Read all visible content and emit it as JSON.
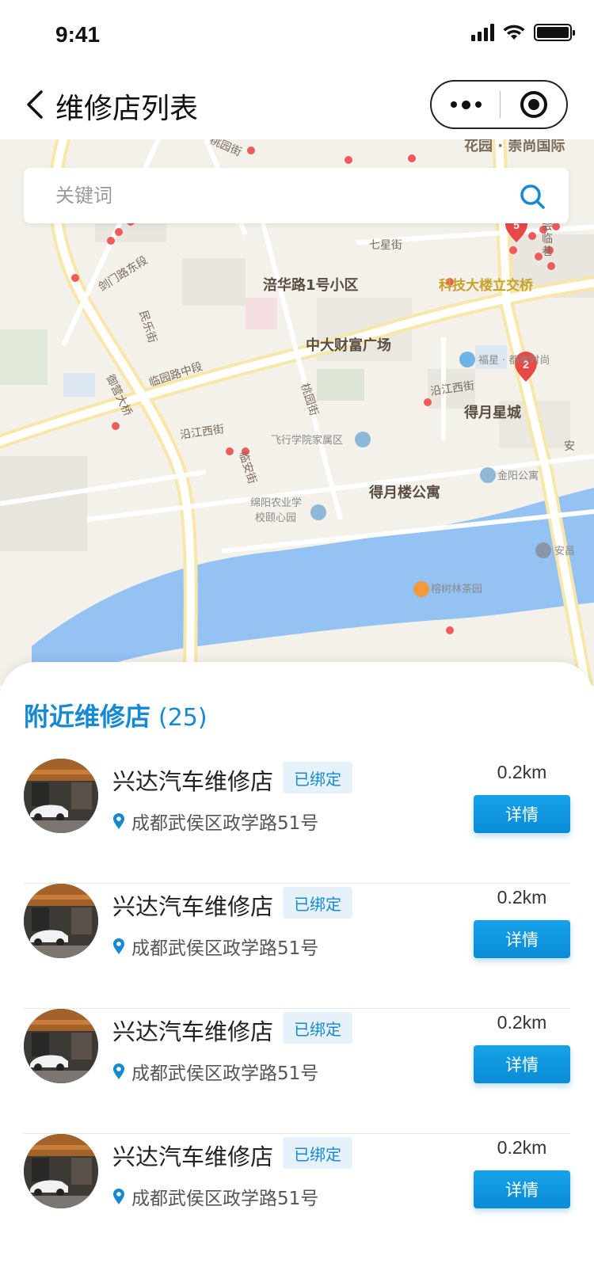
{
  "status_bar": {
    "time": "9:41"
  },
  "nav": {
    "title": "维修店列表"
  },
  "search": {
    "placeholder": "关键词"
  },
  "map": {
    "labels": {
      "l1": "花园 · 崇尚国际",
      "l2": "七星街",
      "l3": "涪华路1号小区",
      "l4": "科技大楼立交桥",
      "l5": "剑门路东段",
      "l6": "民乐街",
      "l7": "中大财富广场",
      "l8": "临园路中段",
      "l9": "福星 · 都市时尚",
      "l10": "沿江西街",
      "l11": "得月星城",
      "l12": "桃园街",
      "l13": "沿江西街",
      "l14": "飞行学院家属区",
      "l15": "临安街",
      "l16": "金阳公寓",
      "l17": "得月楼公寓",
      "l18": "绵阳农业学",
      "l19": "校颐心园",
      "l20": "榕树林茶园",
      "l21": "御营大桥",
      "l22": "桃园街",
      "l23": "安昌",
      "l24": "会",
      "l25": "临",
      "l26": "巷",
      "l27": "路",
      "l28": "安"
    },
    "markers": {
      "m1": "5",
      "m2": "2"
    }
  },
  "panel": {
    "title": "附近维修店",
    "count": "(25)"
  },
  "shops": [
    {
      "name": "兴达汽车维修店",
      "badge": "已绑定",
      "address": "成都武侯区政学路51号",
      "distance": "0.2km",
      "button": "详情"
    },
    {
      "name": "兴达汽车维修店",
      "badge": "已绑定",
      "address": "成都武侯区政学路51号",
      "distance": "0.2km",
      "button": "详情"
    },
    {
      "name": "兴达汽车维修店",
      "badge": "已绑定",
      "address": "成都武侯区政学路51号",
      "distance": "0.2km",
      "button": "详情"
    },
    {
      "name": "兴达汽车维修店",
      "badge": "已绑定",
      "address": "成都武侯区政学路51号",
      "distance": "0.2km",
      "button": "详情"
    }
  ]
}
